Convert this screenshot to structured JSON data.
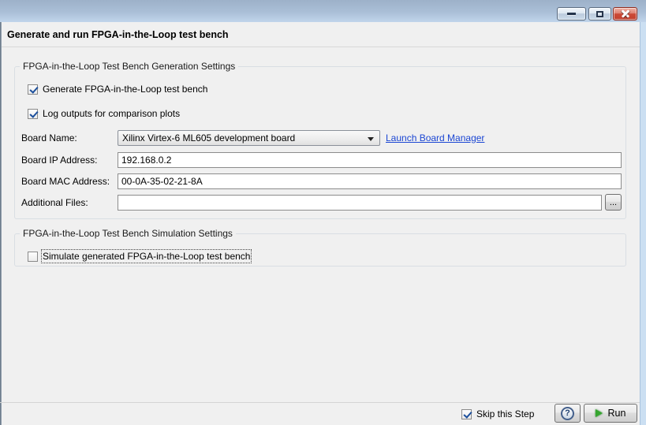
{
  "header": {
    "title": "Generate and run FPGA-in-the-Loop test bench"
  },
  "generation": {
    "legend": "FPGA-in-the-Loop Test Bench Generation Settings",
    "generate_checkbox": {
      "label": "Generate FPGA-in-the-Loop test bench",
      "checked": true
    },
    "log_checkbox": {
      "label": "Log outputs for comparison plots",
      "checked": true
    },
    "board_name": {
      "label": "Board Name:",
      "value": "Xilinx Virtex-6 ML605 development board"
    },
    "board_manager_link": "Launch Board Manager",
    "board_ip": {
      "label": "Board IP Address:",
      "value": "192.168.0.2"
    },
    "board_mac": {
      "label": "Board MAC Address:",
      "value": "00-0A-35-02-21-8A"
    },
    "additional_files": {
      "label": "Additional Files:",
      "value": "",
      "browse": "..."
    }
  },
  "simulation": {
    "legend": "FPGA-in-the-Loop Test Bench Simulation Settings",
    "simulate_checkbox": {
      "label": "Simulate generated FPGA-in-the-Loop test bench",
      "checked": false
    }
  },
  "footer": {
    "skip_checkbox": {
      "label": "Skip this Step",
      "checked": true
    },
    "help": "?",
    "run": "Run"
  },
  "colors": {
    "titlebar_top": "#9db1c9",
    "titlebar_bottom": "#c1d5eb",
    "dialog_background": "#f0f0f0",
    "link": "#1b46d3",
    "check_blue": "#1c4f9c",
    "close_button_red": "#c2402e",
    "run_play_green": "#35a52f",
    "window_edge_blue": "#cbdff2"
  }
}
